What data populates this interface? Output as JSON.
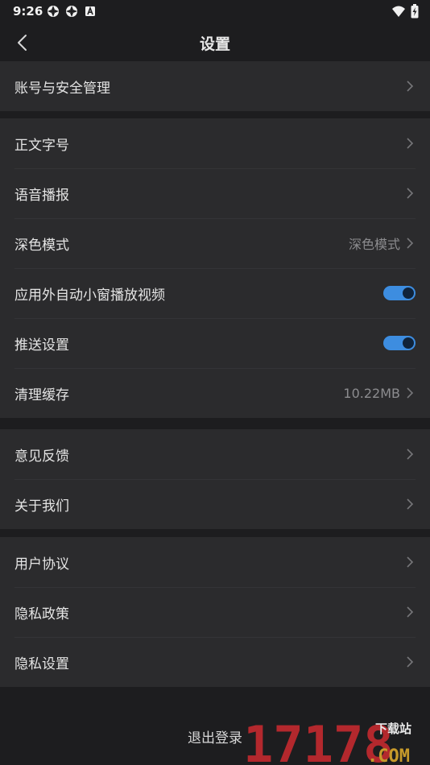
{
  "status_bar": {
    "time": "9:26",
    "icons": [
      "app-notification-icon",
      "app-notification-icon",
      "a-badge-icon"
    ],
    "right_icons": [
      "wifi-icon",
      "battery-charging-icon"
    ]
  },
  "header": {
    "title": "设置",
    "back_icon": "chevron-left-icon"
  },
  "groups": [
    {
      "items": [
        {
          "label": "账号与安全管理",
          "type": "link"
        }
      ]
    },
    {
      "items": [
        {
          "label": "正文字号",
          "type": "link"
        },
        {
          "label": "语音播报",
          "type": "link"
        },
        {
          "label": "深色模式",
          "type": "value",
          "value": "深色模式"
        },
        {
          "label": "应用外自动小窗播放视频",
          "type": "toggle",
          "on": true
        },
        {
          "label": "推送设置",
          "type": "toggle",
          "on": true
        },
        {
          "label": "清理缓存",
          "type": "value",
          "value": "10.22MB"
        }
      ]
    },
    {
      "items": [
        {
          "label": "意见反馈",
          "type": "link"
        },
        {
          "label": "关于我们",
          "type": "link"
        }
      ]
    },
    {
      "items": [
        {
          "label": "用户协议",
          "type": "link"
        },
        {
          "label": "隐私政策",
          "type": "link"
        },
        {
          "label": "隐私设置",
          "type": "link"
        }
      ]
    }
  ],
  "footer": {
    "logout_label": "退出登录"
  },
  "watermark": {
    "top": "下载站",
    "number": "17178",
    "suffix": ".COM"
  },
  "colors": {
    "background": "#1d1d1f",
    "row_background": "#2b2b2d",
    "toggle_on": "#3d8de0",
    "watermark_red": "#b3282d",
    "watermark_gold": "#c79a2a"
  }
}
